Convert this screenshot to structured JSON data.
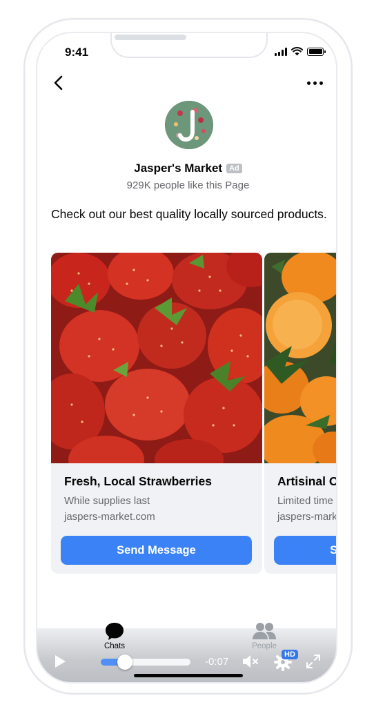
{
  "status_bar": {
    "time": "9:41"
  },
  "header": {
    "back_icon": "chevron-left-icon",
    "more_icon": "more-horizontal-icon"
  },
  "page": {
    "name": "Jasper's Market",
    "ad_label": "Ad",
    "likes": "929K people like this Page",
    "caption": "Check out our best quality locally sourced products."
  },
  "carousel": {
    "cards": [
      {
        "title": "Fresh, Local Strawberries",
        "subtitle": "While supplies last",
        "link": "jaspers-market.com",
        "cta": "Send Message",
        "image": "strawberries-photo"
      },
      {
        "title": "Artisinal Oranges",
        "subtitle": "Limited time",
        "link": "jaspers-market.com",
        "cta": "Send Message",
        "image": "oranges-photo"
      }
    ]
  },
  "tabs": {
    "chats": "Chats",
    "people": "People"
  },
  "player": {
    "time_remaining": "-0:07",
    "progress": 0.27,
    "quality_badge": "HD"
  },
  "colors": {
    "accent": "#3b82f6",
    "secondary_text": "#65676b",
    "card_background": "#f0f2f5",
    "hd_badge": "#3578e5"
  }
}
